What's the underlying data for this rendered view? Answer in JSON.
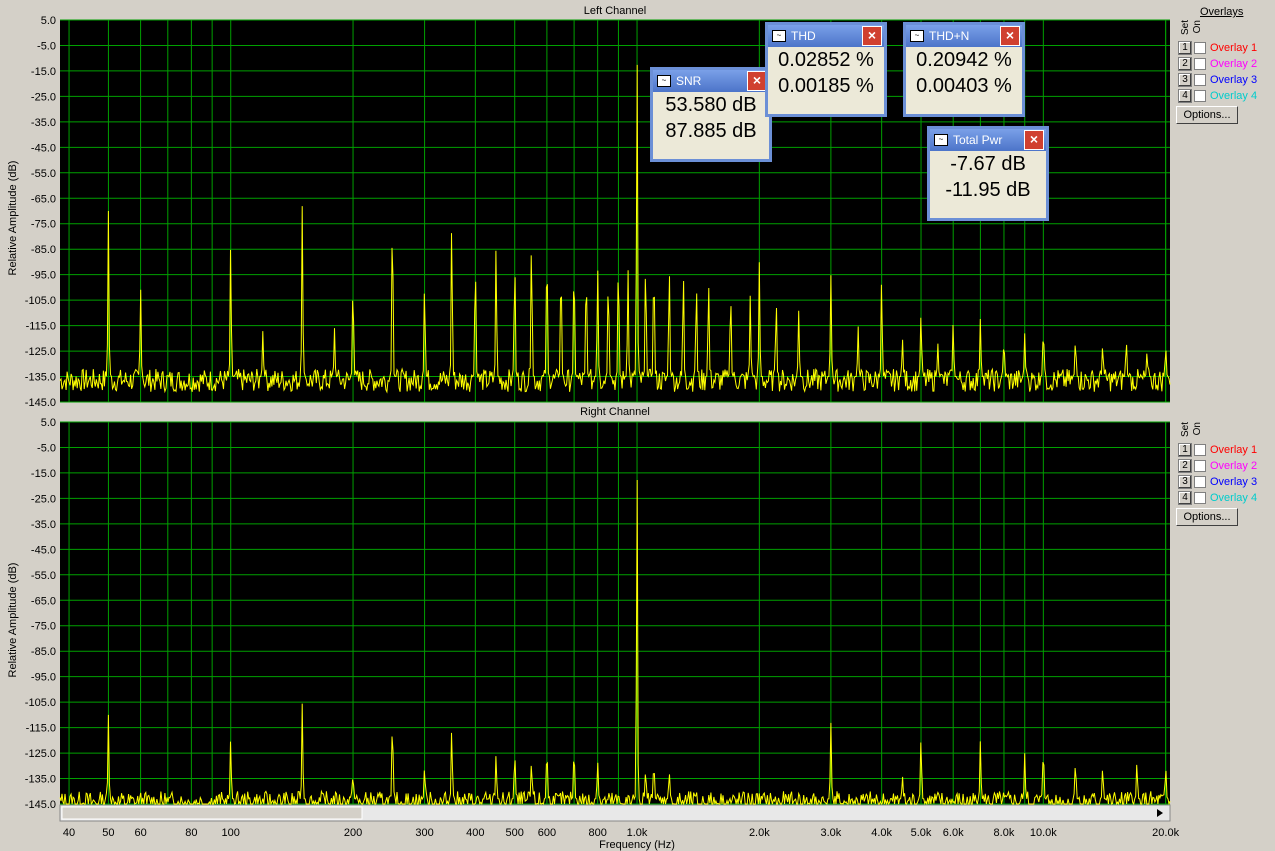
{
  "chart_data": [
    {
      "type": "line",
      "title": "Left Channel",
      "xlabel": "",
      "ylabel": "Relative Amplitude (dB)",
      "xscale": "log",
      "xlim": [
        38,
        20500
      ],
      "ylim": [
        -145,
        5
      ],
      "yticks": [
        "5.0",
        "-5.0",
        "-15.0",
        "-25.0",
        "-35.0",
        "-45.0",
        "-55.0",
        "-65.0",
        "-75.0",
        "-85.0",
        "-95.0",
        "-105.0",
        "-115.0",
        "-125.0",
        "-135.0",
        "-145.0"
      ],
      "noise_floor_db": -135,
      "series": [
        {
          "color": "#ffff00",
          "peaks": [
            {
              "x": 50,
              "y": -70
            },
            {
              "x": 60,
              "y": -100
            },
            {
              "x": 100,
              "y": -82
            },
            {
              "x": 120,
              "y": -117
            },
            {
              "x": 150,
              "y": -67
            },
            {
              "x": 180,
              "y": -116
            },
            {
              "x": 200,
              "y": -96
            },
            {
              "x": 250,
              "y": -67
            },
            {
              "x": 300,
              "y": -97
            },
            {
              "x": 350,
              "y": -72
            },
            {
              "x": 400,
              "y": -87
            },
            {
              "x": 450,
              "y": -82
            },
            {
              "x": 500,
              "y": -86
            },
            {
              "x": 550,
              "y": -80
            },
            {
              "x": 600,
              "y": -81
            },
            {
              "x": 650,
              "y": -88
            },
            {
              "x": 700,
              "y": -87
            },
            {
              "x": 750,
              "y": -90
            },
            {
              "x": 800,
              "y": -91
            },
            {
              "x": 850,
              "y": -93
            },
            {
              "x": 900,
              "y": -86
            },
            {
              "x": 950,
              "y": -92
            },
            {
              "x": 1000,
              "y": -7
            },
            {
              "x": 1050,
              "y": -87
            },
            {
              "x": 1100,
              "y": -88
            },
            {
              "x": 1200,
              "y": -90
            },
            {
              "x": 1300,
              "y": -92
            },
            {
              "x": 1400,
              "y": -96
            },
            {
              "x": 1500,
              "y": -96
            },
            {
              "x": 1700,
              "y": -100
            },
            {
              "x": 1900,
              "y": -103
            },
            {
              "x": 2000,
              "y": -90
            },
            {
              "x": 2200,
              "y": -104
            },
            {
              "x": 2500,
              "y": -109
            },
            {
              "x": 3000,
              "y": -95
            },
            {
              "x": 3500,
              "y": -115
            },
            {
              "x": 4000,
              "y": -95
            },
            {
              "x": 4500,
              "y": -120
            },
            {
              "x": 5000,
              "y": -109
            },
            {
              "x": 5500,
              "y": -122
            },
            {
              "x": 6000,
              "y": -114
            },
            {
              "x": 7000,
              "y": -112
            },
            {
              "x": 8000,
              "y": -120
            },
            {
              "x": 9000,
              "y": -118
            },
            {
              "x": 10000,
              "y": -115
            },
            {
              "x": 12000,
              "y": -120
            },
            {
              "x": 14000,
              "y": -122
            },
            {
              "x": 16000,
              "y": -120
            },
            {
              "x": 18000,
              "y": -125
            },
            {
              "x": 20000,
              "y": -123
            }
          ]
        }
      ]
    },
    {
      "type": "line",
      "title": "Right Channel",
      "xlabel": "Frequency (Hz)",
      "ylabel": "Relative Amplitude (dB)",
      "xscale": "log",
      "xlim": [
        38,
        20500
      ],
      "ylim": [
        -145,
        5
      ],
      "yticks": [
        "5.0",
        "-5.0",
        "-15.0",
        "-25.0",
        "-35.0",
        "-45.0",
        "-55.0",
        "-65.0",
        "-75.0",
        "-85.0",
        "-95.0",
        "-105.0",
        "-115.0",
        "-125.0",
        "-135.0",
        "-145.0"
      ],
      "xticks": [
        {
          "v": 40,
          "label": "40"
        },
        {
          "v": 50,
          "label": "50"
        },
        {
          "v": 60,
          "label": "60"
        },
        {
          "v": 80,
          "label": "80"
        },
        {
          "v": 100,
          "label": "100"
        },
        {
          "v": 200,
          "label": "200"
        },
        {
          "v": 300,
          "label": "300"
        },
        {
          "v": 400,
          "label": "400"
        },
        {
          "v": 500,
          "label": "500"
        },
        {
          "v": 600,
          "label": "600"
        },
        {
          "v": 800,
          "label": "800"
        },
        {
          "v": 1000,
          "label": "1.0k"
        },
        {
          "v": 2000,
          "label": "2.0k"
        },
        {
          "v": 3000,
          "label": "3.0k"
        },
        {
          "v": 4000,
          "label": "4.0k"
        },
        {
          "v": 5000,
          "label": "5.0k"
        },
        {
          "v": 6000,
          "label": "6.0k"
        },
        {
          "v": 8000,
          "label": "8.0k"
        },
        {
          "v": 10000,
          "label": "10.0k"
        },
        {
          "v": 20000,
          "label": "20.0k"
        }
      ],
      "noise_floor_db": -143,
      "series": [
        {
          "color": "#ffff00",
          "peaks": [
            {
              "x": 50,
              "y": -110
            },
            {
              "x": 100,
              "y": -119
            },
            {
              "x": 150,
              "y": -105
            },
            {
              "x": 200,
              "y": -133
            },
            {
              "x": 250,
              "y": -110
            },
            {
              "x": 300,
              "y": -130
            },
            {
              "x": 350,
              "y": -114
            },
            {
              "x": 450,
              "y": -125
            },
            {
              "x": 500,
              "y": -124
            },
            {
              "x": 550,
              "y": -128
            },
            {
              "x": 600,
              "y": -122
            },
            {
              "x": 700,
              "y": -122
            },
            {
              "x": 800,
              "y": -128
            },
            {
              "x": 1000,
              "y": -12
            },
            {
              "x": 1050,
              "y": -131
            },
            {
              "x": 1100,
              "y": -128
            },
            {
              "x": 1200,
              "y": -132
            },
            {
              "x": 3000,
              "y": -113
            },
            {
              "x": 4500,
              "y": -134
            },
            {
              "x": 5000,
              "y": -118
            },
            {
              "x": 7000,
              "y": -120
            },
            {
              "x": 9000,
              "y": -125
            },
            {
              "x": 10000,
              "y": -122
            },
            {
              "x": 12000,
              "y": -128
            },
            {
              "x": 14000,
              "y": -130
            },
            {
              "x": 17000,
              "y": -128
            },
            {
              "x": 20000,
              "y": -130
            }
          ]
        }
      ]
    }
  ],
  "overlay_panel": {
    "title": "Overlays",
    "set_label": "Set",
    "on_label": "On",
    "options_label": "Options...",
    "items": [
      {
        "num": "1",
        "label": "Overlay 1",
        "color": "#ff0000"
      },
      {
        "num": "2",
        "label": "Overlay 2",
        "color": "#ff00ff"
      },
      {
        "num": "3",
        "label": "Overlay 3",
        "color": "#0000ff"
      },
      {
        "num": "4",
        "label": "Overlay 4",
        "color": "#00ffff"
      }
    ]
  },
  "meters": {
    "snr": {
      "title": "SNR",
      "v1": "53.580 dB",
      "v2": "87.885 dB"
    },
    "thd": {
      "title": "THD",
      "v1": "0.02852 %",
      "v2": "0.00185 %"
    },
    "thdn": {
      "title": "THD+N",
      "v1": "0.20942 %",
      "v2": "0.00403 %"
    },
    "totalpwr": {
      "title": "Total Pwr",
      "v1": "-7.67 dB",
      "v2": "-11.95 dB"
    }
  }
}
